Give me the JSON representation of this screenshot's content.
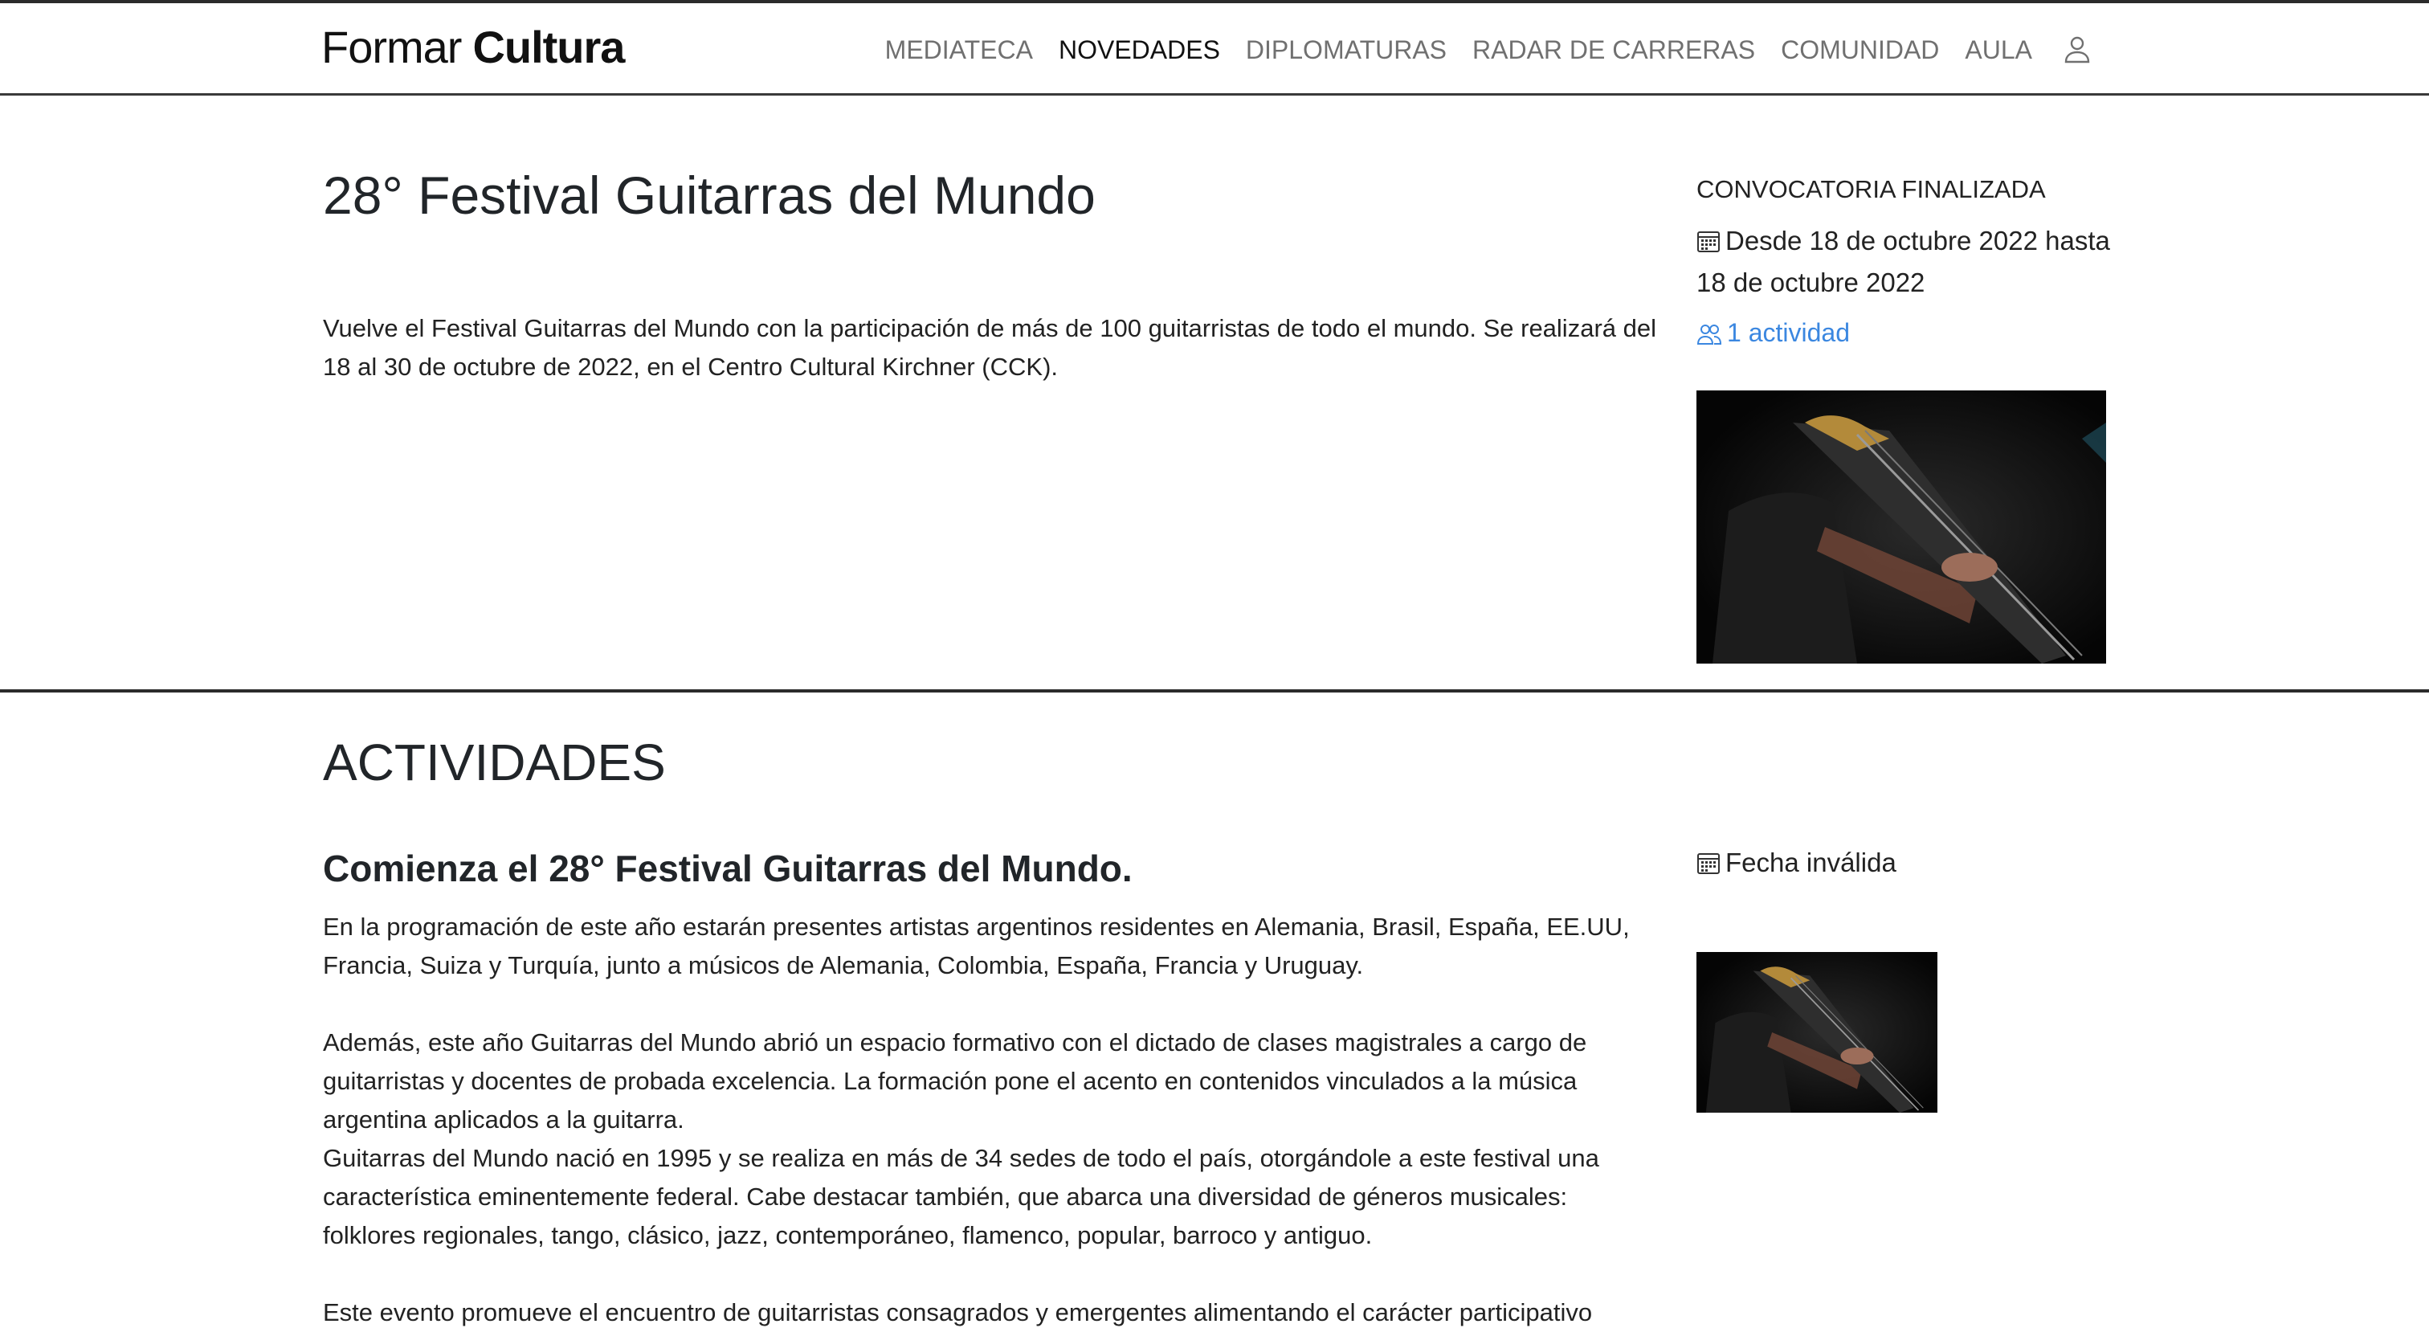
{
  "header": {
    "logo_part1": "Formar",
    "logo_part2": "Cultura",
    "nav": [
      {
        "label": "MEDIATECA"
      },
      {
        "label": "NOVEDADES"
      },
      {
        "label": "DIPLOMATURAS"
      },
      {
        "label": "RADAR DE CARRERAS"
      },
      {
        "label": "COMUNIDAD"
      },
      {
        "label": "AULA"
      }
    ],
    "active_nav": "NOVEDADES",
    "user_icon": "user-icon"
  },
  "event": {
    "title": "28° Festival Guitarras del Mundo",
    "intro": "Vuelve el Festival Guitarras del Mundo con la participación de más de 100 guitarristas de todo el mundo. Se realizará del 18 al 30 de octubre de 2022, en el Centro Cultural Kirchner (CCK).",
    "status": "CONVOCATORIA FINALIZADA",
    "dates": "Desde 18 de octubre 2022 hasta 18 de octubre 2022",
    "activities_count": "1 actividad",
    "image_alt": "guitar player image"
  },
  "activities": {
    "section_title": "ACTIVIDADES",
    "items": [
      {
        "title": "Comienza el 28° Festival Guitarras del Mundo.",
        "date": "Fecha inválida",
        "paragraphs": [
          "En la programación de este año estarán presentes artistas argentinos residentes en Alemania, Brasil, España, EE.UU, Francia, Suiza y Turquía, junto a músicos de Alemania, Colombia, España, Francia y Uruguay.",
          "Además, este año Guitarras del Mundo abrió un espacio formativo con el dictado de clases magistrales a cargo de guitarristas y docentes de probada excelencia. La formación pone el acento en contenidos vinculados a la música argentina aplicados a la guitarra.",
          "Guitarras del Mundo nació en 1995 y se realiza en más de 34 sedes de todo el país, otorgándole a este festival una característica eminentemente federal. Cabe destacar también, que abarca una diversidad de géneros musicales: folklores regionales, tango, clásico, jazz, contemporáneo, flamenco, popular, barroco y antiguo.",
          "Este evento promueve el encuentro de guitarristas consagrados y emergentes alimentando el carácter participativo"
        ]
      }
    ]
  },
  "colors": {
    "accent_link": "#3b87e0",
    "text": "#212529",
    "nav_inactive": "#707070"
  }
}
